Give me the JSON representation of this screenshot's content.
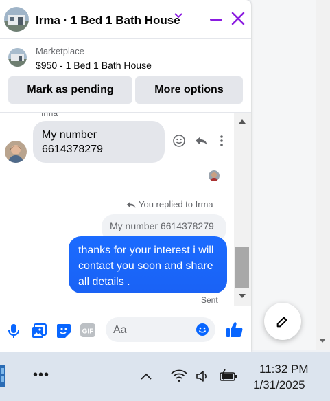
{
  "background": {
    "top_text": "",
    "compose_button": "compose-icon"
  },
  "chat": {
    "title": "Irma · 1 Bed 1 Bath House",
    "listing": {
      "category": "Marketplace",
      "price_title": "$950 - 1 Bed 1 Bath House",
      "buttons": {
        "mark_pending": "Mark as pending",
        "more_options": "More options"
      }
    },
    "messages": {
      "sender_name": "Irma",
      "incoming": {
        "line1": "My number",
        "line2": "6614378279"
      },
      "replied_label": "You replied to Irma",
      "quoted_text": "My number 6614378279",
      "outgoing_text": "thanks for your interest i will contact you soon and share all details .",
      "status": "Sent"
    },
    "composer": {
      "placeholder": "Aa"
    }
  },
  "taskbar": {
    "more": "•••",
    "time": "11:32 PM",
    "date": "1/31/2025"
  },
  "colors": {
    "accent_purple": "#8a1be0",
    "messenger_blue": "#1b6bff",
    "icon_blue": "#0866ff"
  }
}
